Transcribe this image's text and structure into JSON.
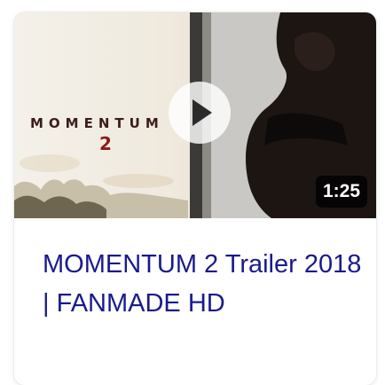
{
  "video": {
    "duration": "1:25",
    "title": "MOMENTUM 2 Trailer 2018 | FANMADE HD",
    "poster": {
      "title_text": "MOMENTUM",
      "number_text": "2"
    },
    "link_color": "#1a1a8c"
  },
  "icons": {
    "play": "play-icon"
  }
}
